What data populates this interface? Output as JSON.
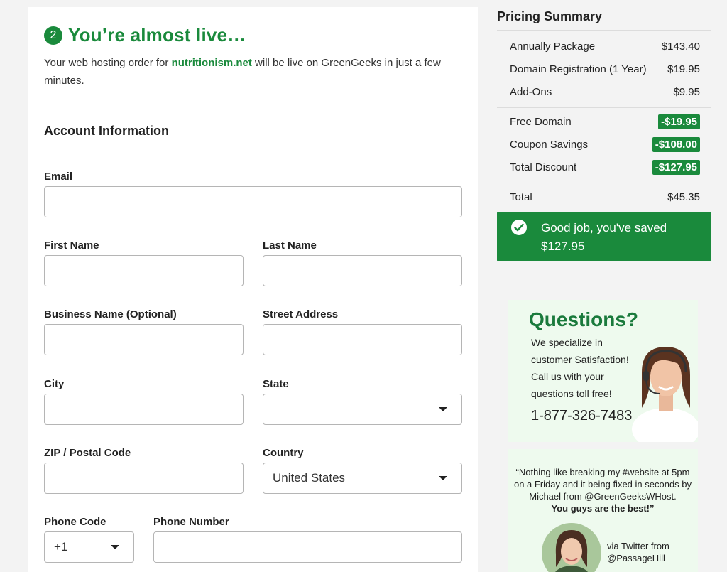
{
  "step": {
    "number": "2",
    "title": "You’re almost live…",
    "intro_prefix": "Your web hosting order for ",
    "domain": "nutritionism.net",
    "intro_suffix": " will be live on GreenGeeks in just a few minutes."
  },
  "account": {
    "heading": "Account Information",
    "fields": {
      "email": {
        "label": "Email",
        "value": ""
      },
      "first_name": {
        "label": "First Name",
        "value": ""
      },
      "last_name": {
        "label": "Last Name",
        "value": ""
      },
      "business_name": {
        "label": "Business Name (Optional)",
        "value": ""
      },
      "street_address": {
        "label": "Street Address",
        "value": ""
      },
      "city": {
        "label": "City",
        "value": ""
      },
      "state": {
        "label": "State",
        "value": ""
      },
      "zip": {
        "label": "ZIP / Postal Code",
        "value": ""
      },
      "country": {
        "label": "Country",
        "value": "United States"
      },
      "phone_code": {
        "label": "Phone Code",
        "value": "+1"
      },
      "phone_number": {
        "label": "Phone Number",
        "value": ""
      }
    }
  },
  "pricing": {
    "title": "Pricing Summary",
    "items": [
      {
        "label": "Annually Package",
        "amount": "$143.40"
      },
      {
        "label": "Domain Registration (1 Year)",
        "amount": "$19.95"
      },
      {
        "label": "Add-Ons",
        "amount": "$9.95"
      }
    ],
    "discounts": [
      {
        "label": "Free Domain",
        "amount": "-$19.95"
      },
      {
        "label": "Coupon Savings",
        "amount": "-$108.00"
      },
      {
        "label": "Total Discount",
        "amount": "-$127.95"
      }
    ],
    "total": {
      "label": "Total",
      "amount": "$45.35"
    },
    "saved_message": "Good job, you've saved $127.95"
  },
  "support": {
    "title": "Questions?",
    "text": "We specialize in customer Satisfaction! Call us with your questions toll free!",
    "phone": "1-877-326-7483"
  },
  "testimonial": {
    "quote": "“Nothing like breaking my #website at 5pm on a Friday and it being fixed in seconds by Michael from @GreenGeeksWHost.",
    "quote_bold": "You guys are the best!”",
    "via_line1": "via Twitter from",
    "via_line2": "@PassageHill"
  },
  "colors": {
    "brand_green": "#1a8a3c",
    "promo_bg": "#eefaee"
  }
}
